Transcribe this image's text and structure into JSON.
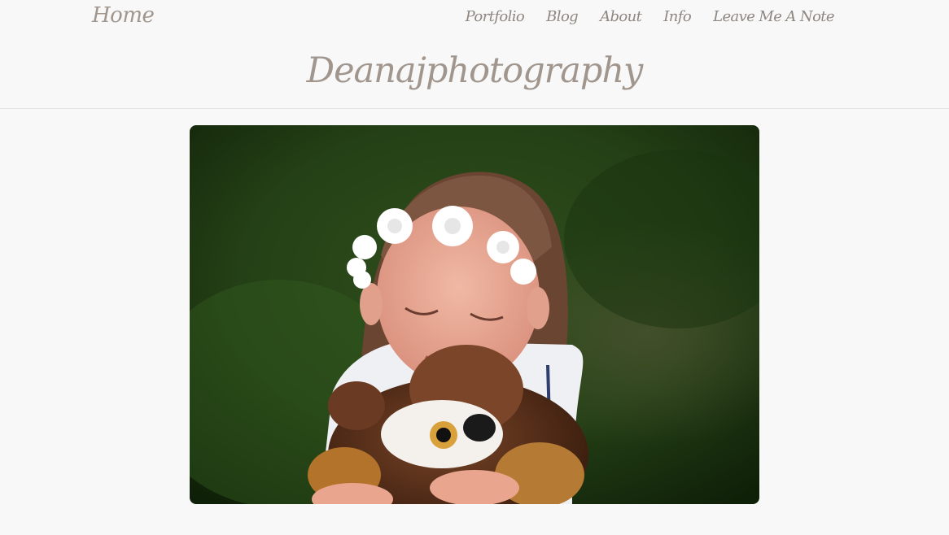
{
  "header": {
    "home_label": "Home",
    "site_title": "Deanajphotography"
  },
  "nav": {
    "items": [
      {
        "label": "Portfolio"
      },
      {
        "label": "Blog"
      },
      {
        "label": "About"
      },
      {
        "label": "Info"
      },
      {
        "label": "Leave Me A Note"
      }
    ]
  },
  "colors": {
    "background": "#f8f8f8",
    "title": "#a1968d",
    "nav": "#8e8780",
    "divider": "#e3e3e3"
  },
  "main": {
    "photo_icon": "featured-photo"
  }
}
